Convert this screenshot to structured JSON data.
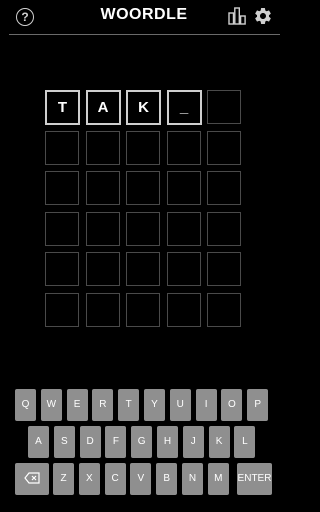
{
  "header": {
    "help_glyph": "?",
    "title": "WOORDLE"
  },
  "board": {
    "rows": [
      [
        "T",
        "A",
        "K",
        "_",
        ""
      ],
      [
        "",
        "",
        "",
        "",
        ""
      ],
      [
        "",
        "",
        "",
        "",
        ""
      ],
      [
        "",
        "",
        "",
        "",
        ""
      ],
      [
        "",
        "",
        "",
        "",
        ""
      ],
      [
        "",
        "",
        "",
        "",
        ""
      ]
    ]
  },
  "keyboard": {
    "row1": [
      "Q",
      "W",
      "E",
      "R",
      "T",
      "Y",
      "U",
      "I",
      "O",
      "P"
    ],
    "row2": [
      "A",
      "S",
      "D",
      "F",
      "G",
      "H",
      "J",
      "K",
      "L"
    ],
    "row3_letters": [
      "Z",
      "X",
      "C",
      "V",
      "B",
      "N",
      "M"
    ],
    "enter_label": "ENTER",
    "backspace_icon": "backspace-icon"
  },
  "colors": {
    "background": "#000000",
    "key": "#8f8f8f",
    "tile_border_empty": "#4a4a4a",
    "tile_border_filled": "#cfcfcf"
  }
}
